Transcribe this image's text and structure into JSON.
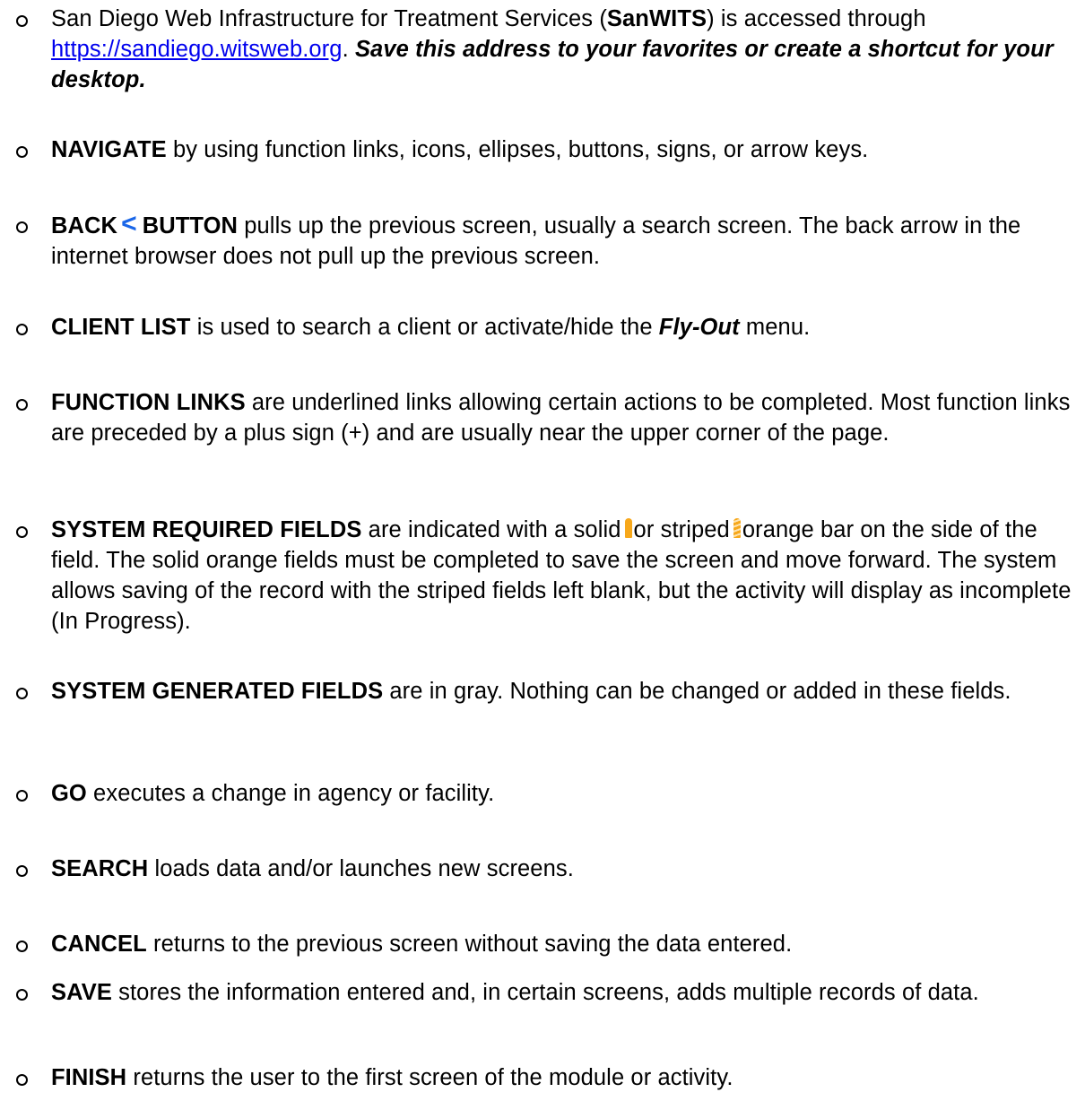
{
  "items": [
    {
      "intro": "San Diego Web Infrastructure for Treatment Services (",
      "acronym": "SanWITS",
      "mid": ") is accessed through ",
      "link": "https://sandiego.witsweb.org",
      "period": ". ",
      "emphasis": "Save this address to your favorites or create a shortcut for your desktop."
    },
    {
      "term": "NAVIGATE",
      "desc": " by using function links, icons, ellipses, buttons, signs, or arrow keys."
    },
    {
      "term": "BACK",
      "symbol": "<",
      "term2": "BUTTON",
      "desc": " pulls up the previous screen, usually a search screen. The back arrow in the internet browser does not pull up the previous screen."
    },
    {
      "term": "CLIENT LIST",
      "desc": " is used to search a client or activate/hide the ",
      "emphasis": "Fly-Out",
      "tail": " menu."
    },
    {
      "term": "FUNCTION LINKS",
      "desc": " are underlined links allowing certain actions to be completed. Most function links are preceded by a plus sign (+) and are usually near the upper corner of the page."
    },
    {
      "term": "SYSTEM REQUIRED FIELDS",
      "desc1": " are indicated with a solid",
      "desc2": "or striped",
      "desc3": "orange bar on the side of the field. The solid orange fields must be completed to save the screen and move forward. The system allows saving of the record with the striped fields left blank, but the activity will display as incomplete (In Progress)."
    },
    {
      "term": "SYSTEM GENERATED FIELDS",
      "desc": " are in gray. Nothing can be changed or added in these fields."
    },
    {
      "term": "GO",
      "desc": " executes a change in agency or facility."
    },
    {
      "term": "SEARCH",
      "desc": " loads data and/or launches new screens."
    },
    {
      "term": "CANCEL",
      "desc": " returns to the previous screen without saving the data entered."
    },
    {
      "term": "SAVE",
      "desc": " stores the information entered and, in certain screens, adds multiple records of data."
    },
    {
      "term": "FINISH",
      "desc": " returns the user to the first screen of the module or activity."
    }
  ],
  "colors": {
    "link": "#0000ee",
    "back_symbol": "#1a66e8",
    "required_bar": "#f7a81b"
  },
  "icons": {
    "bullet": "hollow-circle-bullet",
    "solid_bar": "solid-orange-bar-icon",
    "striped_bar": "striped-orange-bar-icon"
  }
}
